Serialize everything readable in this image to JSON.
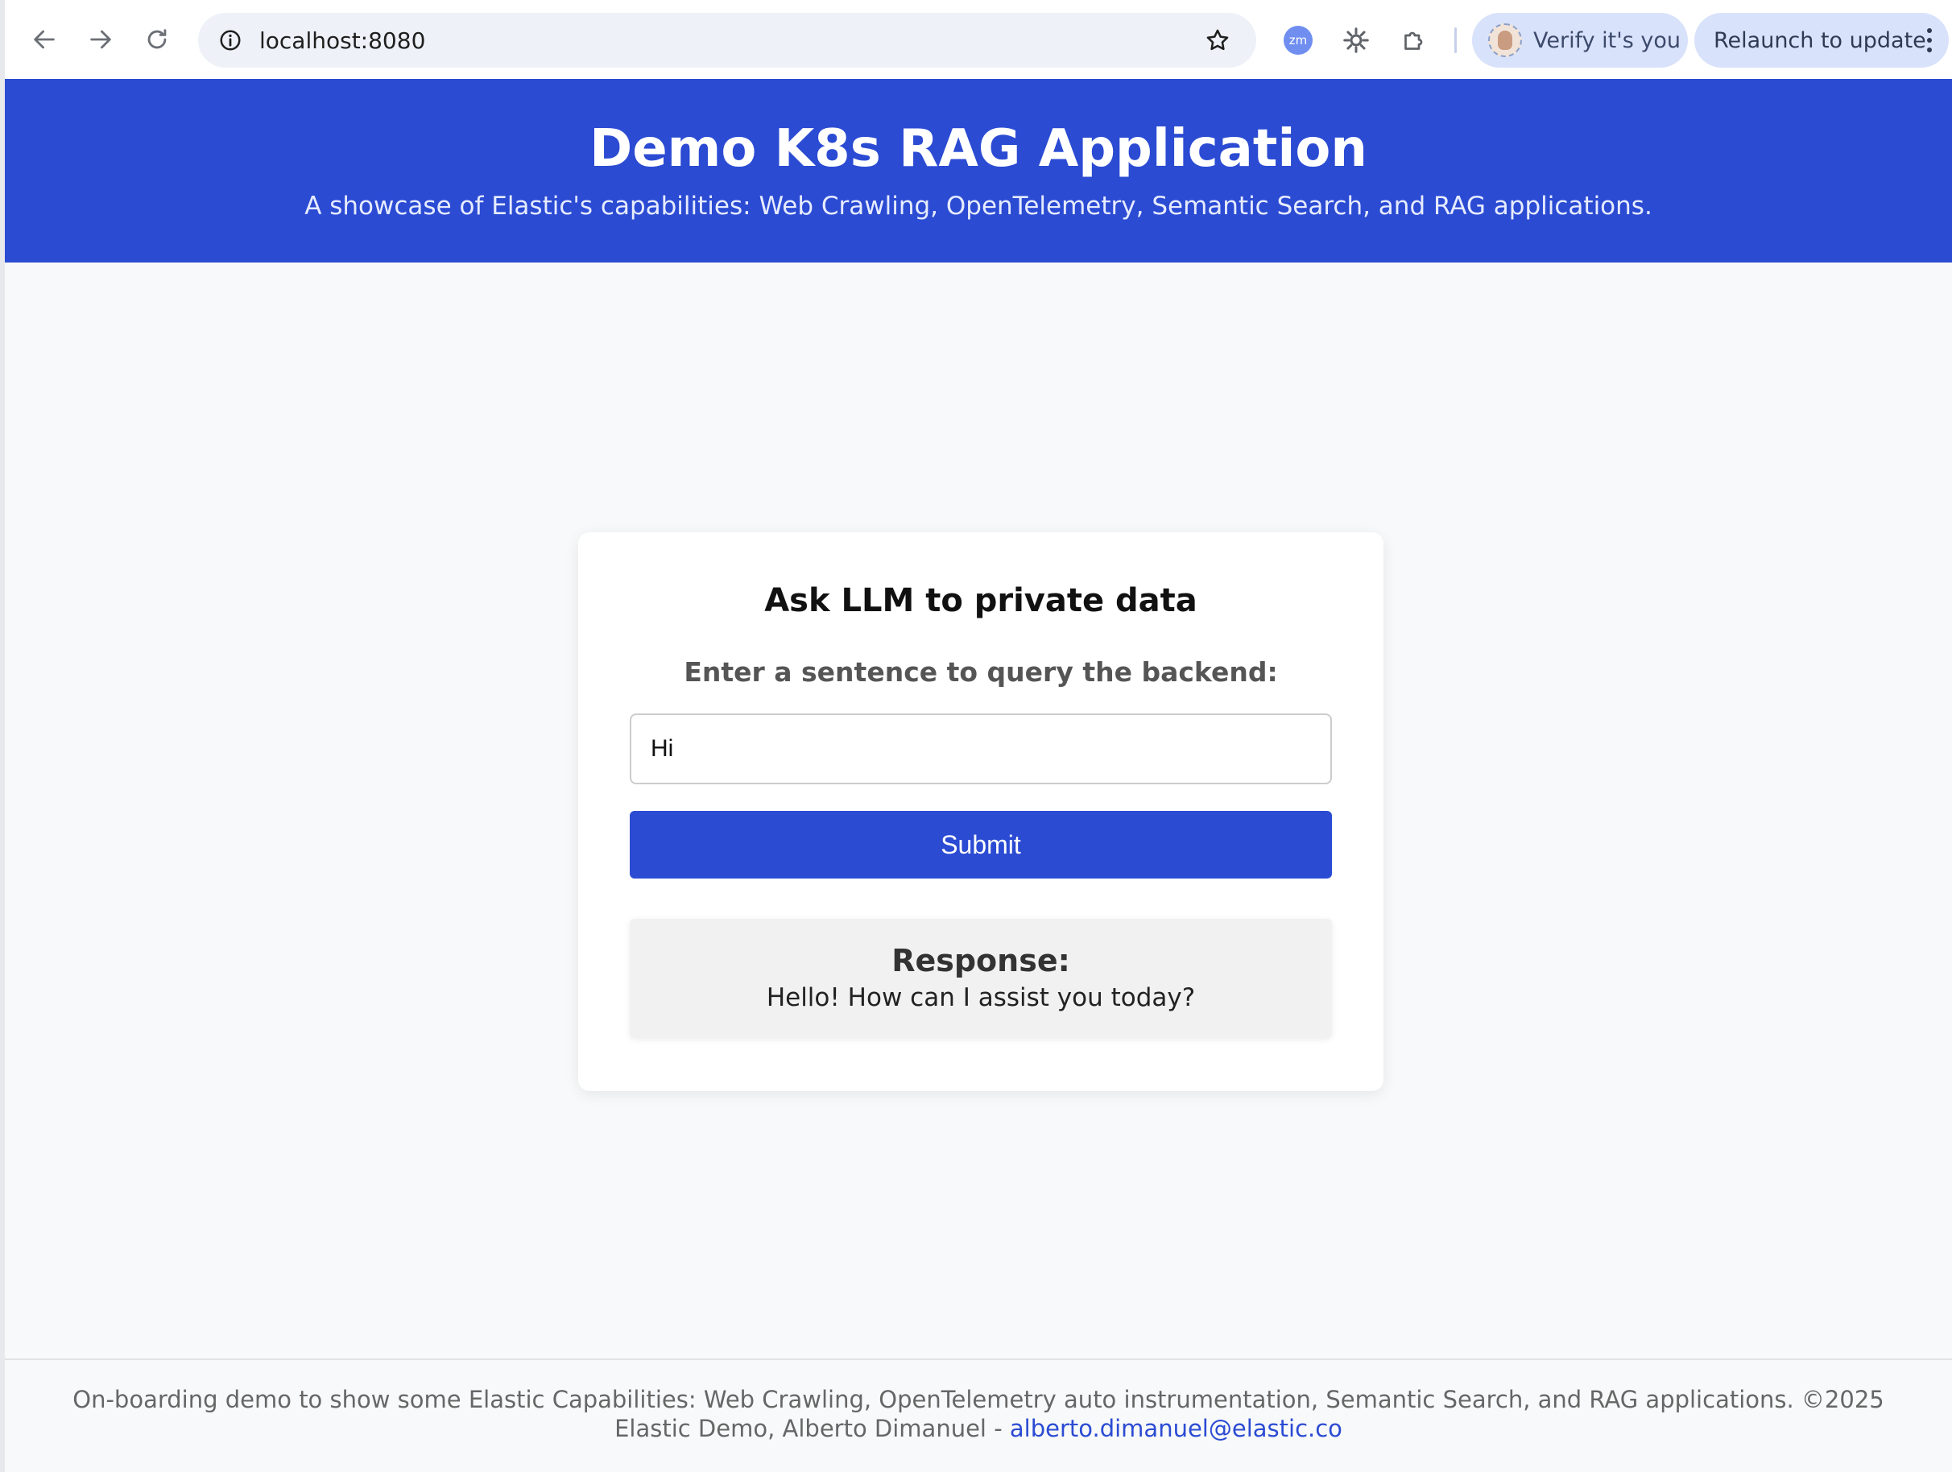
{
  "browser": {
    "url": "localhost:8080",
    "extension_zm_label": "zm",
    "verify_label": "Verify it's you",
    "relaunch_label": "Relaunch to update",
    "icons": [
      "back-icon",
      "forward-icon",
      "reload-icon",
      "info-icon",
      "star-icon",
      "zoom-extension-icon",
      "spinner-extension-icon",
      "puzzle-icon",
      "kebab-menu-icon"
    ]
  },
  "header": {
    "title": "Demo K8s RAG Application",
    "subtitle": "A showcase of Elastic's capabilities: Web Crawling, OpenTelemetry, Semantic Search, and RAG applications."
  },
  "card": {
    "title": "Ask LLM to private data",
    "prompt_label": "Enter a sentence to query the backend:",
    "input_value": "Hi",
    "submit_label": "Submit",
    "response_heading": "Response:",
    "response_text": "Hello! How can I assist you today?"
  },
  "footer": {
    "text": "On-boarding demo to show some Elastic Capabilities: Web Crawling, OpenTelemetry auto instrumentation, Semantic Search, and RAG applications. ©2025 Elastic Demo, Alberto Dimanuel - ",
    "email": "alberto.dimanuel@elastic.co"
  },
  "colors": {
    "brand_blue": "#2b4bd3",
    "page_background": "#f8f9fa",
    "chip_background": "#d9e2fb"
  }
}
